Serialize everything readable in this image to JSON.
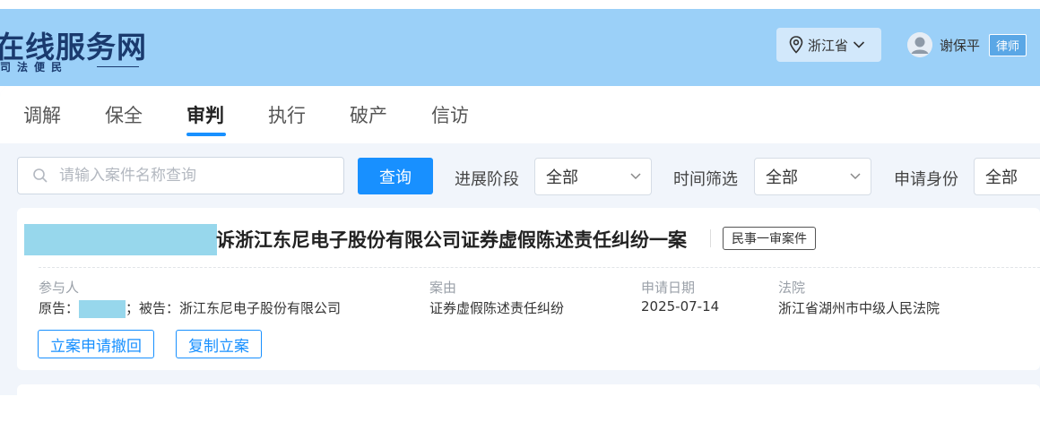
{
  "header": {
    "logo_title": "在线服务网",
    "logo_subtitle": "司法便民",
    "region": "浙江省",
    "user_name": "谢保平",
    "user_role": "律师"
  },
  "tabs": [
    {
      "label": "调解",
      "active": false
    },
    {
      "label": "保全",
      "active": false
    },
    {
      "label": "审判",
      "active": true
    },
    {
      "label": "执行",
      "active": false
    },
    {
      "label": "破产",
      "active": false
    },
    {
      "label": "信访",
      "active": false
    }
  ],
  "search": {
    "placeholder": "请输入案件名称查询",
    "value": "",
    "button_label": "查询"
  },
  "filters": [
    {
      "label": "进展阶段",
      "value": "全部"
    },
    {
      "label": "时间筛选",
      "value": "全部"
    },
    {
      "label": "申请身份",
      "value": "全部"
    }
  ],
  "case": {
    "title": "诉浙江东尼电子股份有限公司证券虚假陈述责任纠纷一案",
    "type_badge": "民事一审案件",
    "participants_label": "参与人",
    "plaintiff_prefix": "原告：",
    "defendant_text": "；被告：浙江东尼电子股份有限公司",
    "cause_label": "案由",
    "cause_value": "证券虚假陈述责任纠纷",
    "date_label": "申请日期",
    "date_value": "2025-07-14",
    "court_label": "法院",
    "court_value": "浙江省湖州市中级人民法院",
    "actions": [
      "立案申请撤回",
      "复制立案"
    ]
  },
  "colors": {
    "header_bg": "#9bd0f8",
    "accent": "#1890ff",
    "redaction": "#97d7ec",
    "panel_bg": "#f1f5fb"
  }
}
